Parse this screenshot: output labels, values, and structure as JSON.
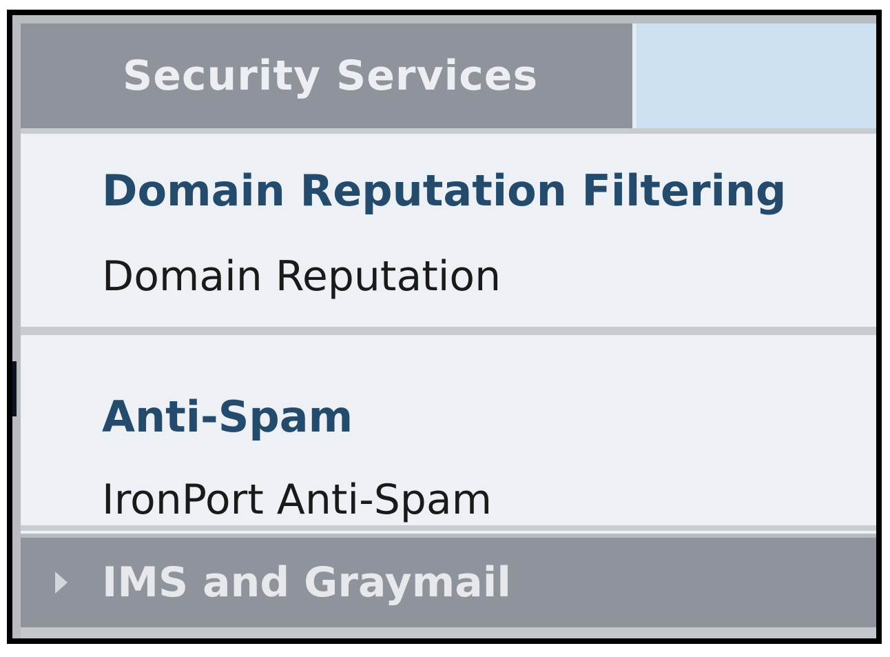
{
  "menu": {
    "tab_label": "Security Services"
  },
  "sections": [
    {
      "heading": "Domain Reputation Filtering",
      "items": [
        "Domain Reputation"
      ]
    },
    {
      "heading": "Anti-Spam",
      "items": [
        "IronPort Anti-Spam"
      ]
    }
  ],
  "collapsed_section": {
    "label": "IMS and Graymail",
    "icon": "triangle-right-icon"
  },
  "colors": {
    "tab_background": "#8f939b",
    "heading_text": "#244a6c",
    "panel_background": "#edf1f5",
    "inactive_tab_area": "#cde0f0"
  }
}
